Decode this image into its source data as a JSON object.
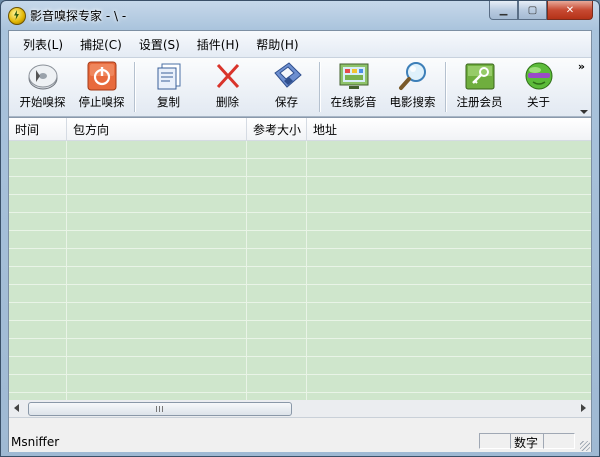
{
  "window": {
    "title": "影音嗅探专家 - \\ -"
  },
  "menu": [
    "列表(L)",
    "捕捉(C)",
    "设置(S)",
    "插件(H)",
    "帮助(H)"
  ],
  "toolbar": {
    "start": "开始嗅探",
    "stop": "停止嗅探",
    "copy": "复制",
    "delete": "删除",
    "save": "保存",
    "online": "在线影音",
    "movie_search": "电影搜索",
    "register": "注册会员",
    "about": "关于",
    "overflow": "»"
  },
  "list": {
    "columns": [
      "时间",
      "包方向",
      "参考大小",
      "地址"
    ]
  },
  "scroll": {
    "grip": "III"
  },
  "status": {
    "main": "Msniffer",
    "mode": "数字"
  },
  "colors": {
    "row_bg": "#cfe6cc",
    "row_line": "#e9f4e7",
    "close_btn": "#c74a32"
  }
}
